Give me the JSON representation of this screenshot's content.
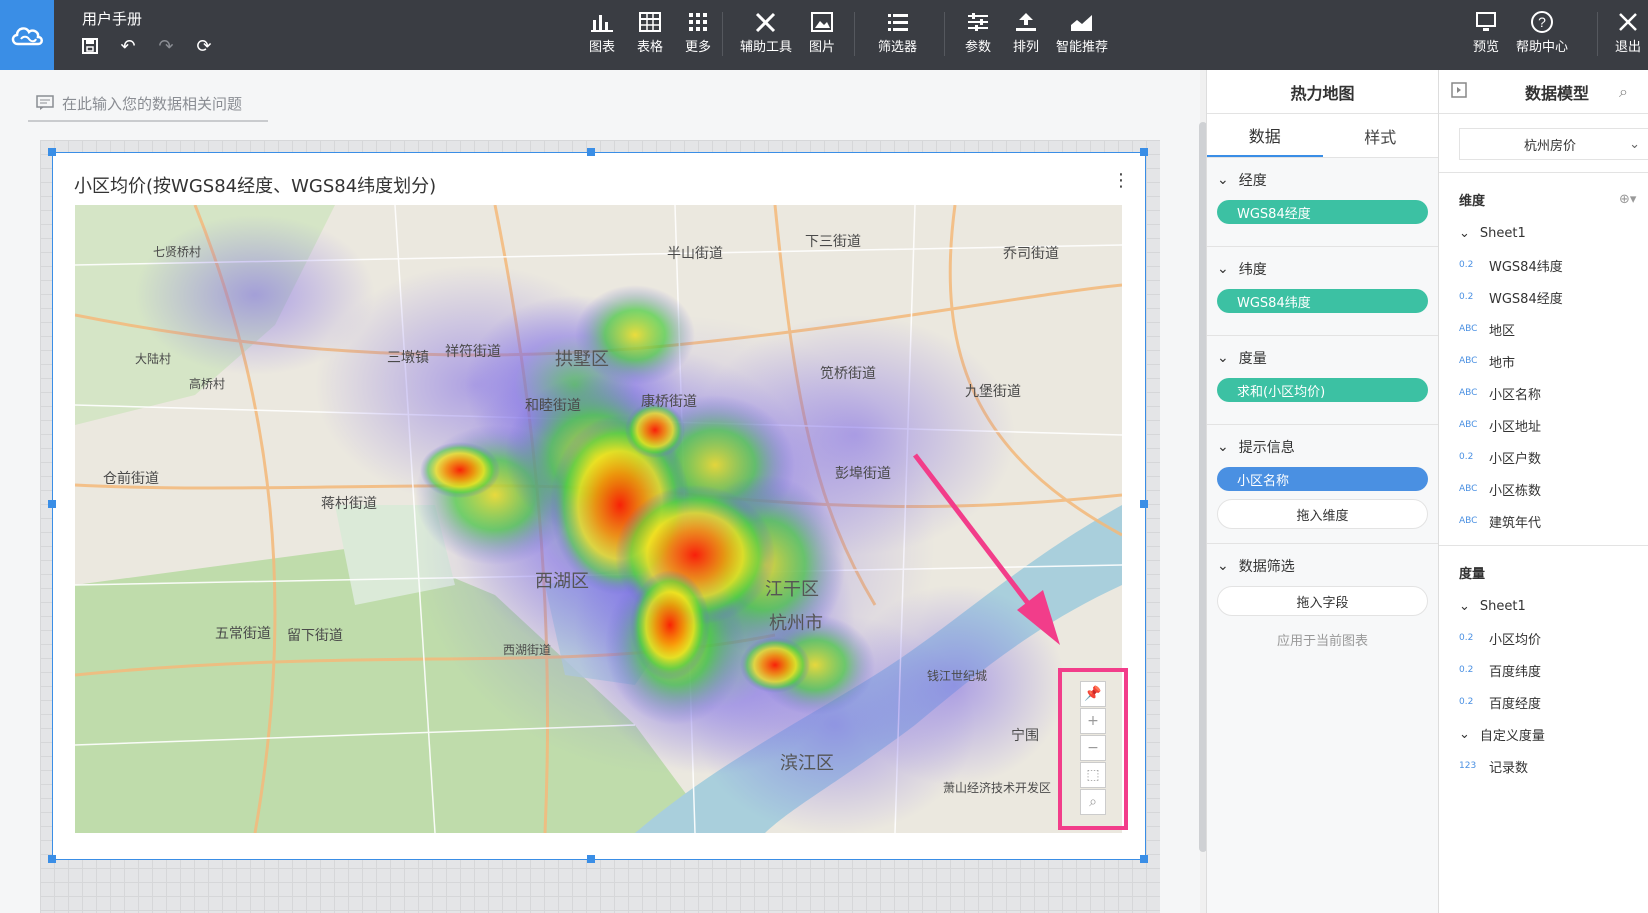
{
  "app": {
    "doc_title": "用户手册"
  },
  "toolbar": {
    "chart": "图表",
    "table": "表格",
    "more": "更多",
    "aux_tools": "辅助工具",
    "image": "图片",
    "filter": "筛选器",
    "params": "参数",
    "sort": "排列",
    "smart": "智能推荐",
    "preview": "预览",
    "help": "帮助中心",
    "exit": "退出"
  },
  "ask": {
    "placeholder": "在此输入您的数据相关问题"
  },
  "widget": {
    "title": "小区均价(按WGS84经度、WGS84纬度划分)"
  },
  "map_labels": [
    "下三街道",
    "乔司街道",
    "七贤桥村",
    "半山街道",
    "三墩镇",
    "祥符街道",
    "大陆村",
    "高桥村",
    "拱墅区",
    "康桥街道",
    "笕桥街道",
    "九堡街道",
    "和睦街道",
    "仓前街道",
    "蒋村街道",
    "彭埠街道",
    "西湖区",
    "江干区",
    "杭州市",
    "五常街道",
    "留下街道",
    "西湖街道",
    "钱江世纪城",
    "宁围",
    "滨江区",
    "萧山经济技术开发区"
  ],
  "config": {
    "title": "热力地图",
    "tabs": [
      "数据",
      "样式"
    ],
    "longitude": {
      "label": "经度",
      "field": "WGS84经度"
    },
    "latitude": {
      "label": "纬度",
      "field": "WGS84纬度"
    },
    "measure": {
      "label": "度量",
      "field": "求和(小区均价)"
    },
    "tooltip": {
      "label": "提示信息",
      "field": "小区名称",
      "drop": "拖入维度"
    },
    "filter": {
      "label": "数据筛选",
      "drop": "拖入字段",
      "hint": "应用于当前图表"
    }
  },
  "model": {
    "title": "数据模型",
    "dataset": "杭州房价",
    "dimensions": {
      "label": "维度",
      "sheet": "Sheet1",
      "fields": [
        {
          "tag": "0.2",
          "name": "WGS84纬度"
        },
        {
          "tag": "0.2",
          "name": "WGS84经度"
        },
        {
          "tag": "ABC",
          "name": "地区"
        },
        {
          "tag": "ABC",
          "name": "地市"
        },
        {
          "tag": "ABC",
          "name": "小区名称"
        },
        {
          "tag": "ABC",
          "name": "小区地址"
        },
        {
          "tag": "0.2",
          "name": "小区户数"
        },
        {
          "tag": "ABC",
          "name": "小区栋数"
        },
        {
          "tag": "ABC",
          "name": "建筑年代"
        }
      ]
    },
    "measures": {
      "label": "度量",
      "sheet": "Sheet1",
      "fields": [
        {
          "tag": "0.2",
          "name": "小区均价"
        },
        {
          "tag": "0.2",
          "name": "百度纬度"
        },
        {
          "tag": "0.2",
          "name": "百度经度"
        }
      ],
      "custom": "自定义度量",
      "custom_fields": [
        {
          "tag": "123",
          "name": "记录数"
        }
      ]
    }
  }
}
